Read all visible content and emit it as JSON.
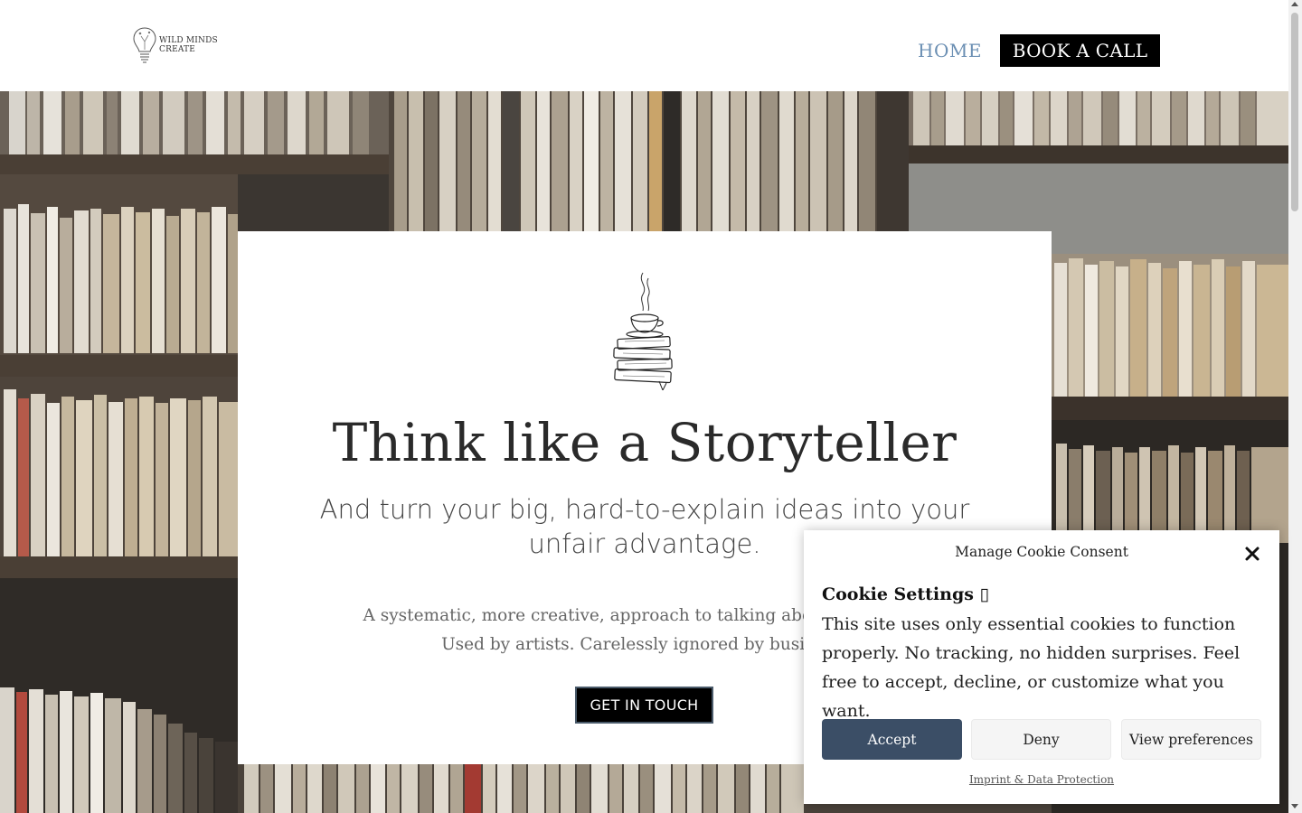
{
  "header": {
    "logo_text_line1": "WILD MINDS",
    "logo_text_line2": "CREATE",
    "nav_home": "HOME",
    "nav_book": "BOOK A CALL",
    "nav_home_color": "#6b8fb3"
  },
  "hero": {
    "title": "Think like a Storyteller",
    "subtitle": "And turn your big, hard-to-explain ideas into your unfair advantage.",
    "body_line1": "A systematic, more creative, approach to talking about your work.",
    "body_line2": "Used by artists. Carelessly ignored by business.",
    "cta": "GET IN TOUCH",
    "illustration": "coffee-cup-on-books"
  },
  "cookie": {
    "heading": "Manage Cookie Consent",
    "title": "Cookie Settings ▯",
    "text": "This site uses only essential cookies to function properly. No tracking, no hidden surprises. Feel free to accept, decline, or customize what you want.",
    "accept": "Accept",
    "deny": "Deny",
    "preferences": "View preferences",
    "link": "Imprint & Data Protection",
    "accent": "#3b4e66"
  }
}
